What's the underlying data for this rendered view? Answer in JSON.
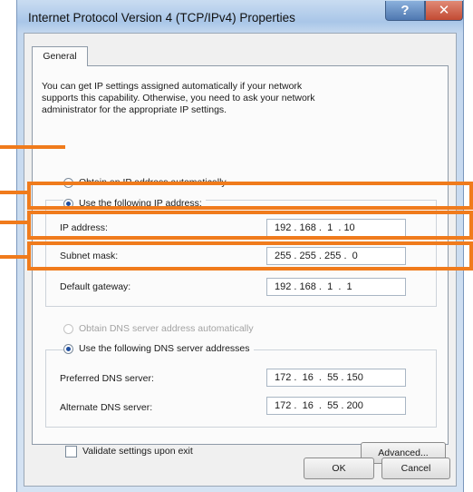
{
  "window": {
    "title": "Internet Protocol Version 4 (TCP/IPv4) Properties",
    "help_label": "?",
    "close_label": "✕"
  },
  "tab": {
    "label": "General"
  },
  "intro_text": "You can get IP settings assigned automatically if your network\nsupports this capability. Otherwise, you need to ask your network\nadministrator for the appropriate IP settings.",
  "ip_section": {
    "auto_label": "Obtain an IP address automatically",
    "auto_selected": false,
    "manual_label": "Use the following IP address:",
    "manual_selected": true,
    "fields": [
      {
        "label": "IP address:",
        "value": "192 . 168 .  1  . 10"
      },
      {
        "label": "Subnet mask:",
        "value": "255 . 255 . 255 .  0"
      },
      {
        "label": "Default gateway:",
        "value": "192 . 168 .  1  .  1"
      }
    ]
  },
  "dns_section": {
    "auto_label": "Obtain DNS server address automatically",
    "auto_disabled": true,
    "manual_label": "Use the following DNS server addresses",
    "manual_selected": true,
    "fields": [
      {
        "label": "Preferred DNS server:",
        "value": "172 .  16  .  55 . 150"
      },
      {
        "label": "Alternate DNS server:",
        "value": "172 .  16  .  55 . 200"
      }
    ]
  },
  "validate": {
    "label": "Validate settings upon exit",
    "checked": false
  },
  "buttons": {
    "advanced": "Advanced...",
    "ok": "OK",
    "cancel": "Cancel"
  },
  "annotation_color": "#f07b1c"
}
